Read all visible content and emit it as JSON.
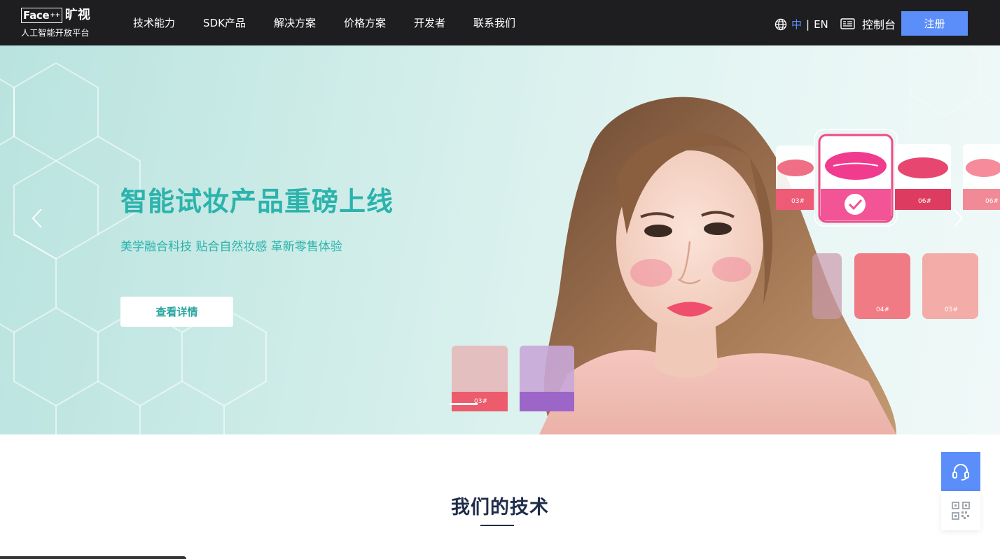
{
  "brand": {
    "logo_en": "Face",
    "logo_sup": "++",
    "logo_cn": "旷视",
    "tagline": "人工智能开放平台"
  },
  "nav": {
    "items": [
      {
        "label": "技术能力"
      },
      {
        "label": "SDK产品"
      },
      {
        "label": "解决方案"
      },
      {
        "label": "价格方案"
      },
      {
        "label": "开发者"
      },
      {
        "label": "联系我们"
      }
    ],
    "lang_cn": "中",
    "lang_sep": "|",
    "lang_en": "EN",
    "console_label": "控制台",
    "register_label": "注册",
    "accent": "#5b8ef9"
  },
  "hero": {
    "title": "智能试妆产品重磅上线",
    "subtitle": "美学融合科技 贴合自然妆感 革新零售体验",
    "cta_label": "查看详情",
    "accent": "#2bb3ac",
    "slides_count": 1,
    "active_slide": 1,
    "swatch_labels": {
      "lip_left": "03#",
      "lip_selected": "",
      "lip_06": "06#",
      "lip_far": "06#",
      "blush_04": "04#",
      "blush_05": "05#",
      "bottom_swatch": "03#"
    }
  },
  "section": {
    "title": "我们的技术"
  },
  "float": {
    "support_icon": "headset-icon",
    "qr_icon": "qr-code-icon"
  }
}
